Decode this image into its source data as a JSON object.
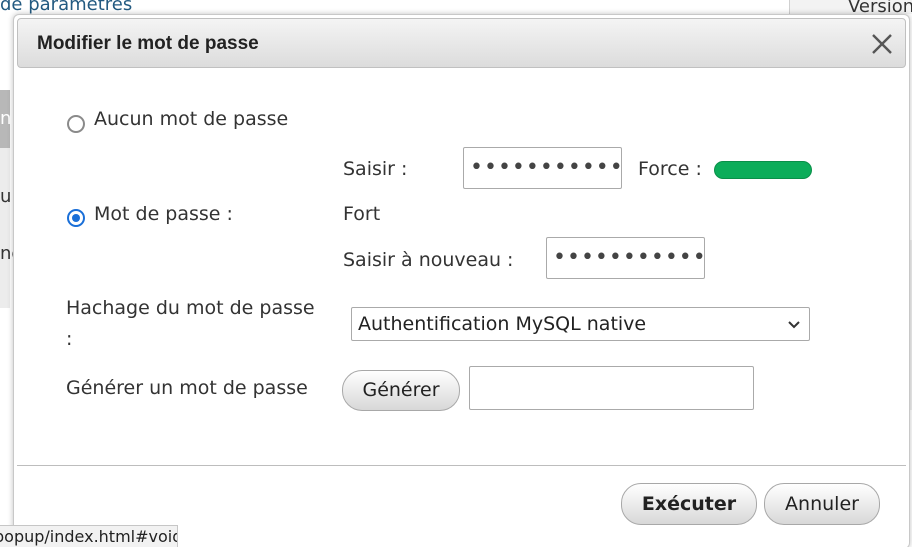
{
  "background": {
    "top_link": "de paramètres",
    "top_right_text": "Version",
    "left_fragments": [
      "n",
      "u",
      "ne"
    ]
  },
  "dialog": {
    "title": "Modifier le mot de passe",
    "no_password_label": "Aucun mot de passe",
    "password_label": "Mot de passe :",
    "enter_label": "Saisir :",
    "password_value": "•••••••••••••",
    "strength_label": "Force :",
    "strength_text": "Fort",
    "strength_color": "#0cad5a",
    "reenter_label": "Saisir à nouveau :",
    "reenter_value": "•••••••••••••",
    "hashing_label_line1": "Hachage du mot de passe",
    "hashing_label_line2": ":",
    "hashing_selected": "Authentification MySQL native",
    "generate_label": "Générer un mot de passe",
    "generate_button": "Générer",
    "generated_value": "",
    "execute_button": "Exécuter",
    "cancel_button": "Annuler"
  },
  "status_bar": {
    "url": "popup/index.html#void"
  },
  "selected_radio": "password"
}
